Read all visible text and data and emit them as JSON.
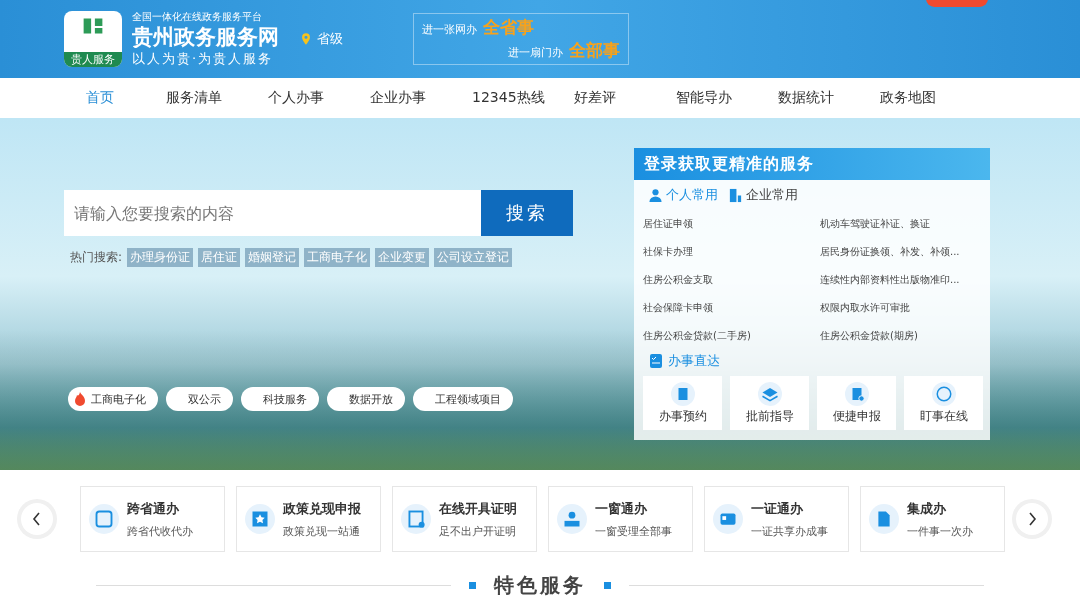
{
  "header": {
    "logo_badge": "贵人服务",
    "platform": "全国一体化在线政务服务平台",
    "site_name": "贵州政务服务网",
    "motto": "以人为贵·为贵人服务",
    "location": "省级",
    "slogan": [
      {
        "lead": "进一张网办",
        "strong": "全省事"
      },
      {
        "lead": "进一扇门办",
        "strong": "全部事"
      }
    ]
  },
  "nav": [
    {
      "label": "首页",
      "selected": true
    },
    {
      "label": "服务清单",
      "selected": false
    },
    {
      "label": "个人办事",
      "selected": false
    },
    {
      "label": "企业办事",
      "selected": false
    },
    {
      "label": "12345热线",
      "selected": false
    },
    {
      "label": "好差评",
      "selected": false
    },
    {
      "label": "智能导办",
      "selected": false
    },
    {
      "label": "数据统计",
      "selected": false
    },
    {
      "label": "政务地图",
      "selected": false
    }
  ],
  "search": {
    "placeholder": "请输入您要搜索的内容",
    "button": "搜索",
    "hot_label": "热门搜索:",
    "hot": [
      "办理身份证",
      "居住证",
      "婚姻登记",
      "工商电子化",
      "企业变更",
      "公司设立登记"
    ]
  },
  "shortcuts": [
    {
      "label": "工商电子化",
      "hot": true
    },
    {
      "label": "双公示",
      "hot": false
    },
    {
      "label": "科技服务",
      "hot": false
    },
    {
      "label": "数据开放",
      "hot": false
    },
    {
      "label": "工程领域项目",
      "hot": false
    }
  ],
  "login_panel": {
    "title": "登录获取更精准的服务",
    "tabs": [
      {
        "label": "个人常用",
        "selected": true,
        "kind": "person"
      },
      {
        "label": "企业常用",
        "selected": false,
        "kind": "company"
      }
    ],
    "items": [
      "居住证申领",
      "机动车驾驶证补证、换证",
      "社保卡办理",
      "居民身份证换领、补发、补领...",
      "住房公积金支取",
      "连续性内部资料性出版物准印...",
      "社会保障卡申领",
      "权限内取水许可审批",
      "住房公积金贷款(二手房)",
      "住房公积金贷款(期房)"
    ],
    "direct_title": "办事直达",
    "direct": [
      {
        "label": "办事预约",
        "kind": "doc"
      },
      {
        "label": "批前指导",
        "kind": "layers"
      },
      {
        "label": "便捷申报",
        "kind": "report"
      },
      {
        "label": "盯事在线",
        "kind": "ding"
      }
    ]
  },
  "services": [
    {
      "title": "跨省通办",
      "subtitle": "跨省代收代办",
      "kind": "kua"
    },
    {
      "title": "政策兑现申报",
      "subtitle": "政策兑现一站通",
      "kind": "star"
    },
    {
      "title": "在线开具证明",
      "subtitle": "足不出户开证明",
      "kind": "cert"
    },
    {
      "title": "一窗通办",
      "subtitle": "一窗受理全部事",
      "kind": "window"
    },
    {
      "title": "一证通办",
      "subtitle": "一证共享办成事",
      "kind": "card"
    },
    {
      "title": "集成办",
      "subtitle": "一件事一次办",
      "kind": "file"
    }
  ],
  "section_title": "特色服务"
}
